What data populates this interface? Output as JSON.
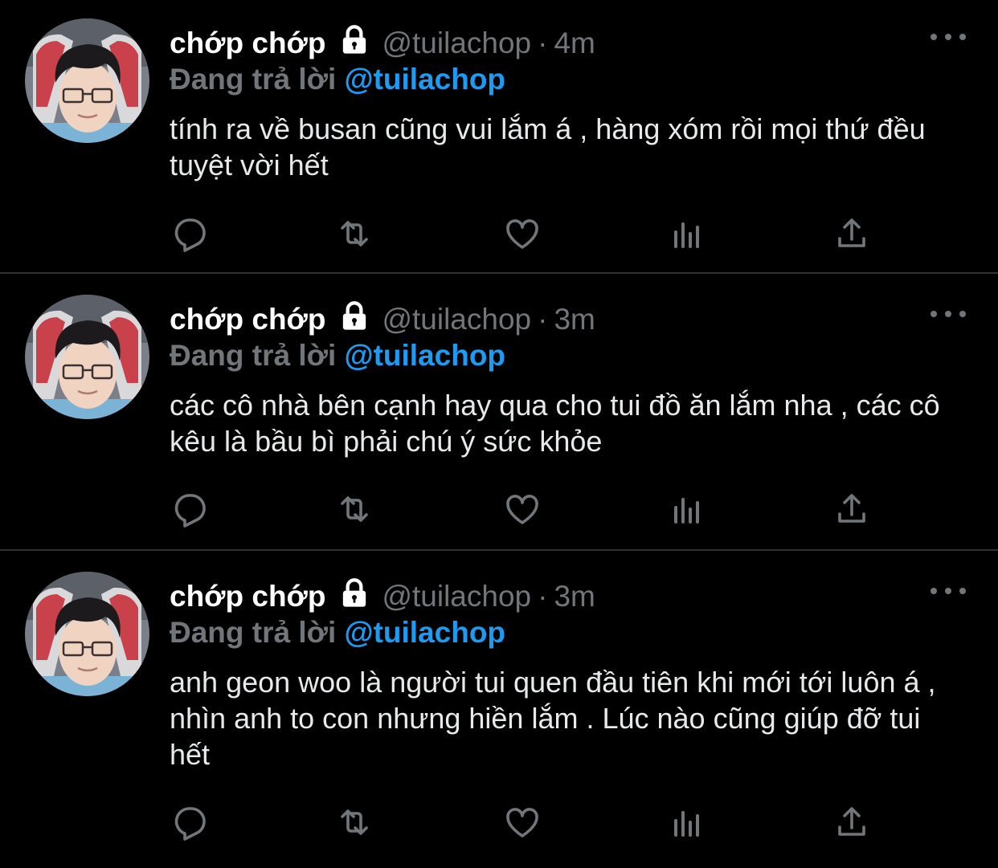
{
  "colors": {
    "background": "#000000",
    "text": "#e7e9ea",
    "muted": "#71767b",
    "mention": "#1d9bf0",
    "divider": "#2f3336"
  },
  "icons": [
    "lock-icon",
    "more-icon",
    "reply-icon",
    "retweet-icon",
    "like-icon",
    "analytics-icon",
    "share-icon"
  ],
  "tweets": [
    {
      "name": "chớp chớp",
      "handle": "@tuilachop",
      "separator": "·",
      "time": "4m",
      "reply_prefix": "Đang trả lời",
      "reply_to": "@tuilachop",
      "text": "tính ra về busan cũng vui lắm á , hàng xóm rồi mọi thứ đều tuyệt vời hết"
    },
    {
      "name": "chớp chớp",
      "handle": "@tuilachop",
      "separator": "·",
      "time": "3m",
      "reply_prefix": "Đang trả lời",
      "reply_to": "@tuilachop",
      "text": "các cô nhà bên cạnh hay qua cho tui đồ ăn lắm nha , các cô kêu là bầu bì phải chú ý sức khỏe"
    },
    {
      "name": "chớp chớp",
      "handle": "@tuilachop",
      "separator": "·",
      "time": "3m",
      "reply_prefix": "Đang trả lời",
      "reply_to": "@tuilachop",
      "text": "anh geon woo là người tui quen đầu tiên khi mới tới luôn á , nhìn anh to con nhưng hiền lắm . Lúc nào cũng giúp đỡ tui hết"
    }
  ]
}
